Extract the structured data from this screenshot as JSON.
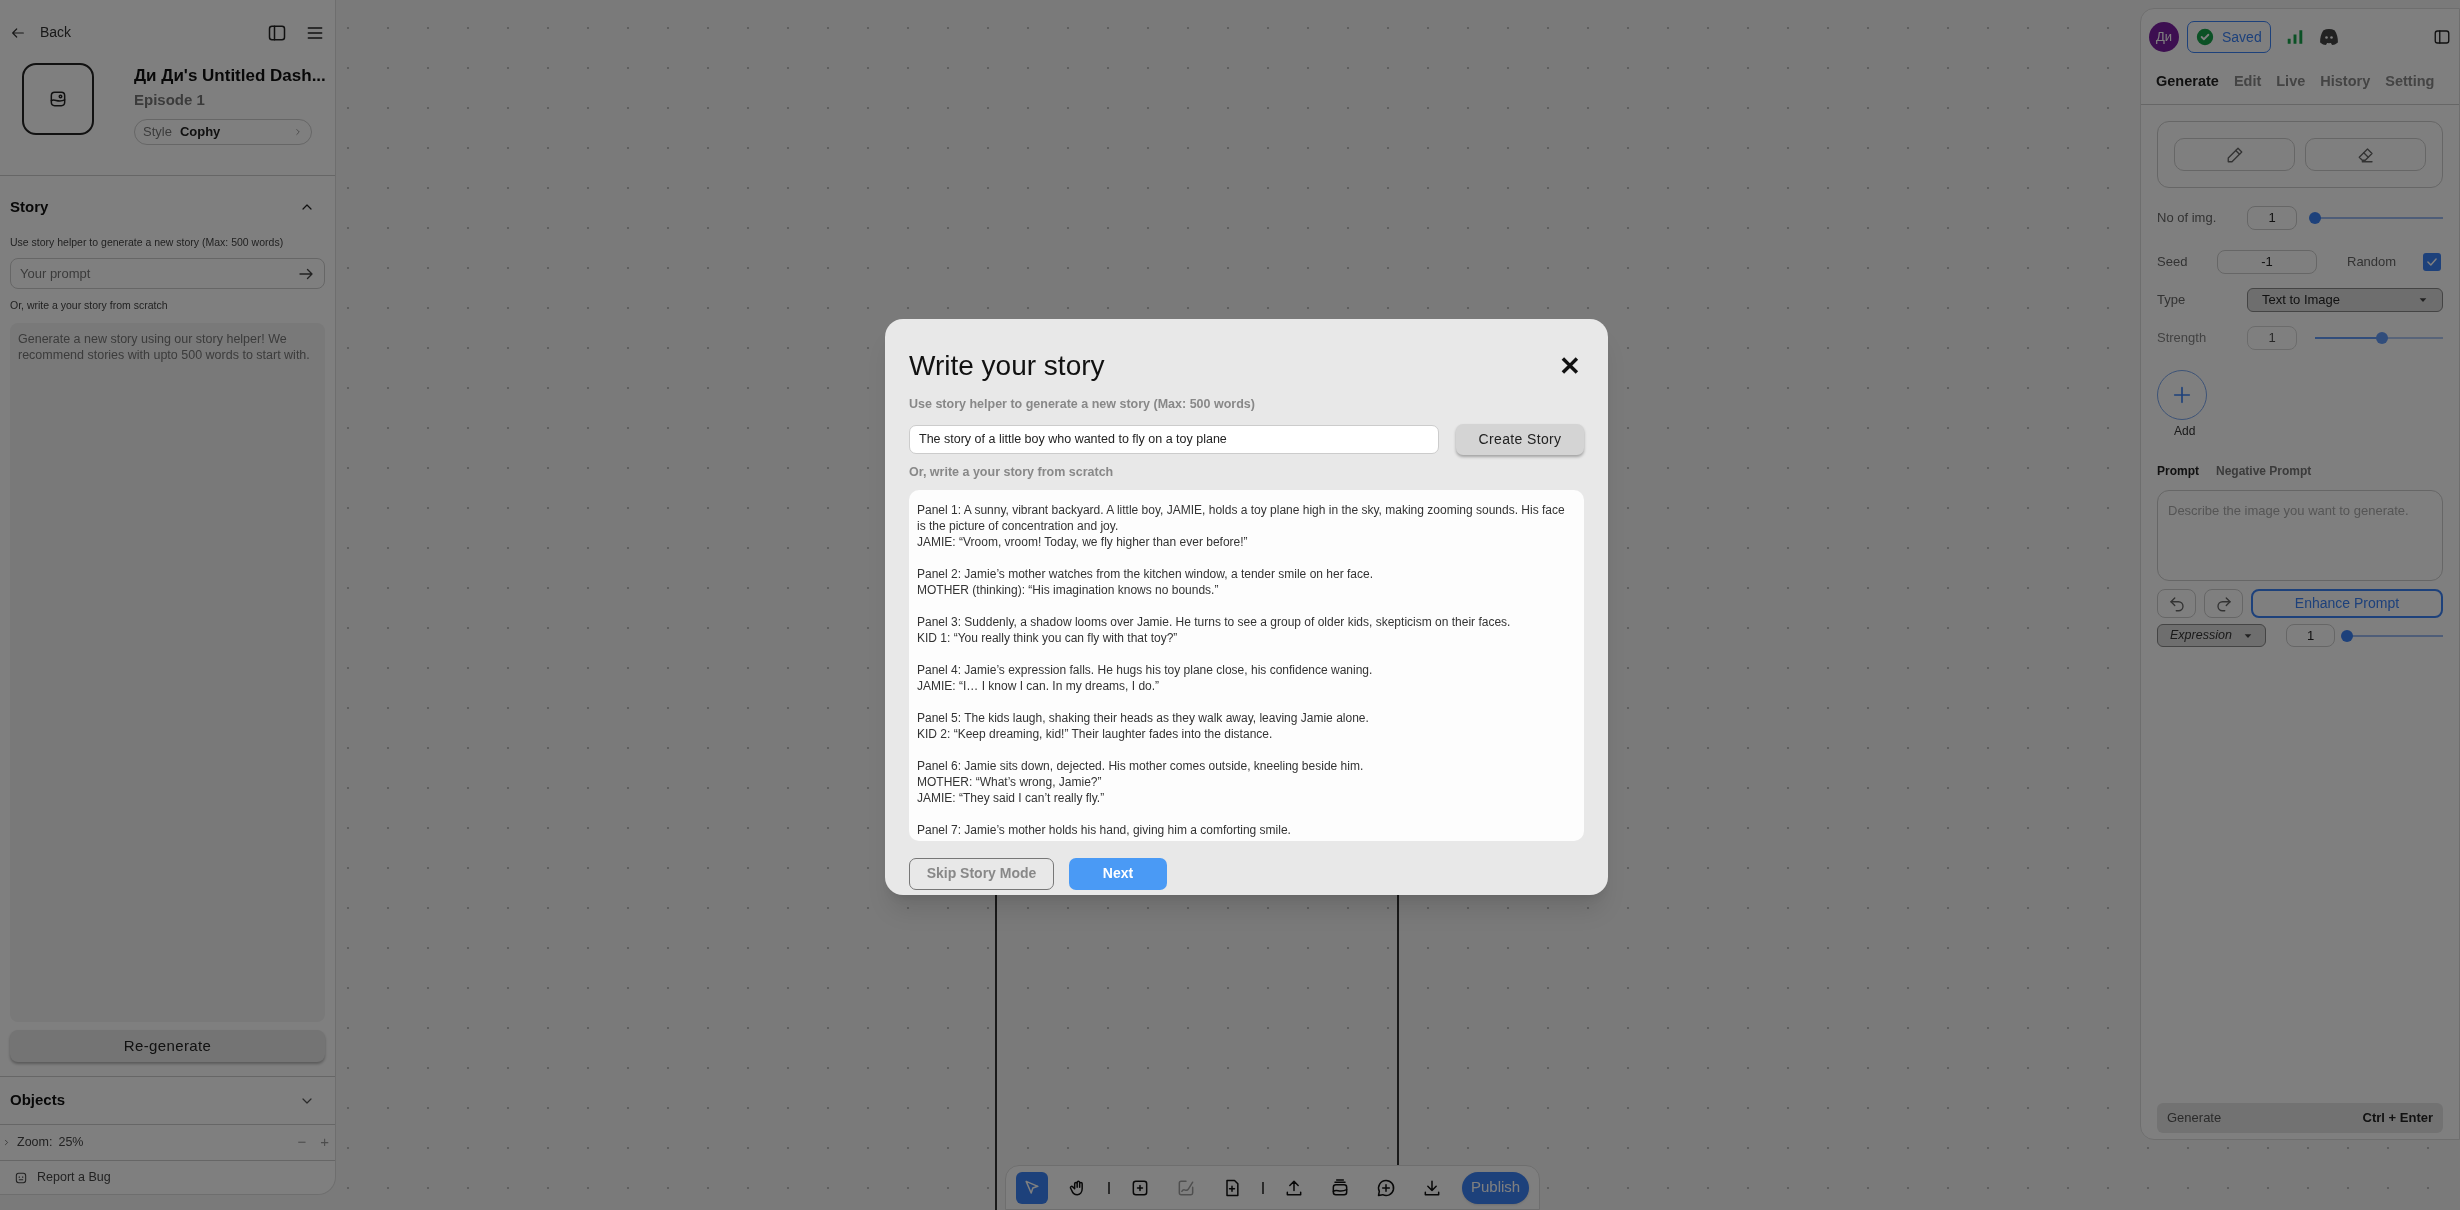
{
  "left_panel": {
    "back": "Back",
    "project_title": "Ди Ди's Untitled Dash...",
    "episode": "Episode 1",
    "style_label": "Style",
    "style_value": "Cophy",
    "story_section": {
      "title": "Story",
      "expanded": true,
      "helper": "Use story helper to generate a new story (Max: 500 words)",
      "prompt_placeholder": "Your prompt",
      "scratch_label": "Or, write a your story from scratch",
      "story_placeholder": "Generate a new story using our story helper! We recommend stories with upto 500 words to start with.",
      "regenerate": "Re-generate"
    },
    "objects_section": {
      "title": "Objects",
      "expanded": false
    },
    "zoom": {
      "label": "Zoom:",
      "value": "25%",
      "minus": "−",
      "plus": "+"
    },
    "report_bug": "Report a Bug"
  },
  "toolbar": {
    "groups": [
      [
        {
          "selected": true,
          "disabled": false
        },
        {
          "selected": false,
          "disabled": false
        }
      ],
      [
        {
          "selected": false,
          "disabled": false
        },
        {
          "selected": false,
          "disabled": true
        },
        {
          "selected": false,
          "disabled": false
        }
      ],
      [
        {
          "selected": false,
          "disabled": false
        },
        {
          "selected": false,
          "disabled": false
        },
        {
          "selected": false,
          "disabled": false
        },
        {
          "selected": false,
          "disabled": false
        }
      ]
    ],
    "publish": "Publish"
  },
  "right_panel": {
    "avatar": "Ди",
    "saved": "Saved",
    "tabs": [
      {
        "label": "Generate",
        "selected": true
      },
      {
        "label": "Edit",
        "selected": false
      },
      {
        "label": "Live",
        "selected": false
      },
      {
        "label": "History",
        "selected": false
      },
      {
        "label": "Setting",
        "selected": false
      }
    ],
    "no_of_img": {
      "label": "No of img.",
      "value": "1",
      "level": 0
    },
    "seed": {
      "label": "Seed",
      "value": "-1",
      "random_label": "Random",
      "random_checked": true
    },
    "type": {
      "label": "Type",
      "value": "Text to Image"
    },
    "strength": {
      "label": "Strength",
      "value": "1",
      "level": 0.55,
      "disabled": true
    },
    "add": "Add",
    "prompt_tabs": [
      {
        "label": "Prompt",
        "selected": true
      },
      {
        "label": "Negative Prompt",
        "selected": false
      }
    ],
    "prompt_placeholder": "Describe the image you want to generate.",
    "enhance": "Enhance Prompt",
    "expression": {
      "label": "Expression",
      "value": "1",
      "level": 0
    },
    "generate": "Generate",
    "shortcut": "Ctrl + Enter"
  },
  "modal": {
    "title": "Write your story",
    "close": "✕",
    "helper": "Use story helper to generate a new story (Max: 500 words)",
    "prompt_value": "The story of a little boy who wanted to fly on a toy plane",
    "create": "Create Story",
    "scratch_label": "Or, write a your story from scratch",
    "story": [
      "Panel 1: A sunny, vibrant backyard. A little boy, JAMIE, holds a toy plane high in the sky, making zooming sounds. His face is the picture of concentration and joy.\nJAMIE: “Vroom, vroom! Today, we fly higher than ever before!”",
      "Panel 2: Jamie’s mother watches from the kitchen window, a tender smile on her face.\nMOTHER (thinking): “His imagination knows no bounds.”",
      "Panel 3: Suddenly, a shadow looms over Jamie. He turns to see a group of older kids, skepticism on their faces.\nKID 1: “You really think you can fly with that toy?”",
      "Panel 4: Jamie’s expression falls. He hugs his toy plane close, his confidence waning.\nJAMIE: “I… I know I can. In my dreams, I do.”",
      "Panel 5: The kids laugh, shaking their heads as they walk away, leaving Jamie alone.\nKID 2: “Keep dreaming, kid!” Their laughter fades into the distance.",
      "Panel 6: Jamie sits down, dejected. His mother comes outside, kneeling beside him.\nMOTHER: “What’s wrong, Jamie?”\nJAMIE: “They said I can’t really fly.”",
      "Panel 7: Jamie’s mother holds his hand, giving him a comforting smile."
    ],
    "skip": "Skip Story Mode",
    "next": "Next"
  }
}
